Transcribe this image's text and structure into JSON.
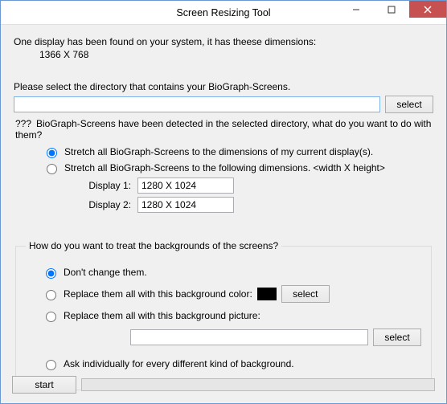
{
  "window": {
    "title": "Screen Resizing Tool"
  },
  "info": {
    "line1": "One display has been found on your system, it has theese dimensions:",
    "dims": "1366 X 768"
  },
  "dir": {
    "prompt": "Please select the directory that contains your BioGraph-Screens.",
    "value": "",
    "select_label": "select"
  },
  "detect": {
    "qmarks": "???",
    "line": "BioGraph-Screens have been detected in the selected directory, what do you want to do with them?",
    "opt_stretch_current": "Stretch all BioGraph-Screens to the dimensions of my current display(s).",
    "opt_stretch_custom": "Stretch all BioGraph-Screens to the following dimensions. <width X height>",
    "display1_label": "Display 1:",
    "display1_value": "1280 X 1024",
    "display2_label": "Display 2:",
    "display2_value": "1280 X 1024"
  },
  "bg": {
    "legend": "How do you want to treat the backgrounds of the screens?",
    "opt_dont": "Don't change them.",
    "opt_color": "Replace them all with this background color:",
    "color_value": "#000000",
    "color_select": "select",
    "opt_picture": "Replace them all with this background picture:",
    "picture_value": "",
    "picture_select": "select",
    "opt_ask": "Ask individually for every different kind of background."
  },
  "bottom": {
    "start": "start"
  }
}
